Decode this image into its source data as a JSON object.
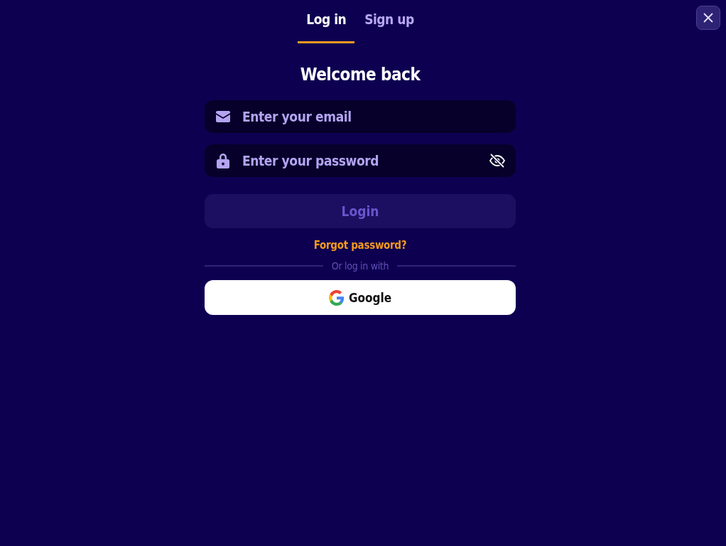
{
  "tabs": [
    {
      "label": "Log in",
      "selected": true
    },
    {
      "label": "Sign up",
      "selected": false
    }
  ],
  "heading": "Welcome back",
  "fields": [
    {
      "kind": "email",
      "placeholder": "Enter your email"
    },
    {
      "kind": "password",
      "placeholder": "Enter your password",
      "revealed": false
    }
  ],
  "login_button": {
    "label": "Login",
    "disabled": true
  },
  "forgot_link": "Forgot password?",
  "divider_text": "Or log in with",
  "social_buttons": [
    {
      "kind": "google",
      "label": "Google"
    }
  ]
}
